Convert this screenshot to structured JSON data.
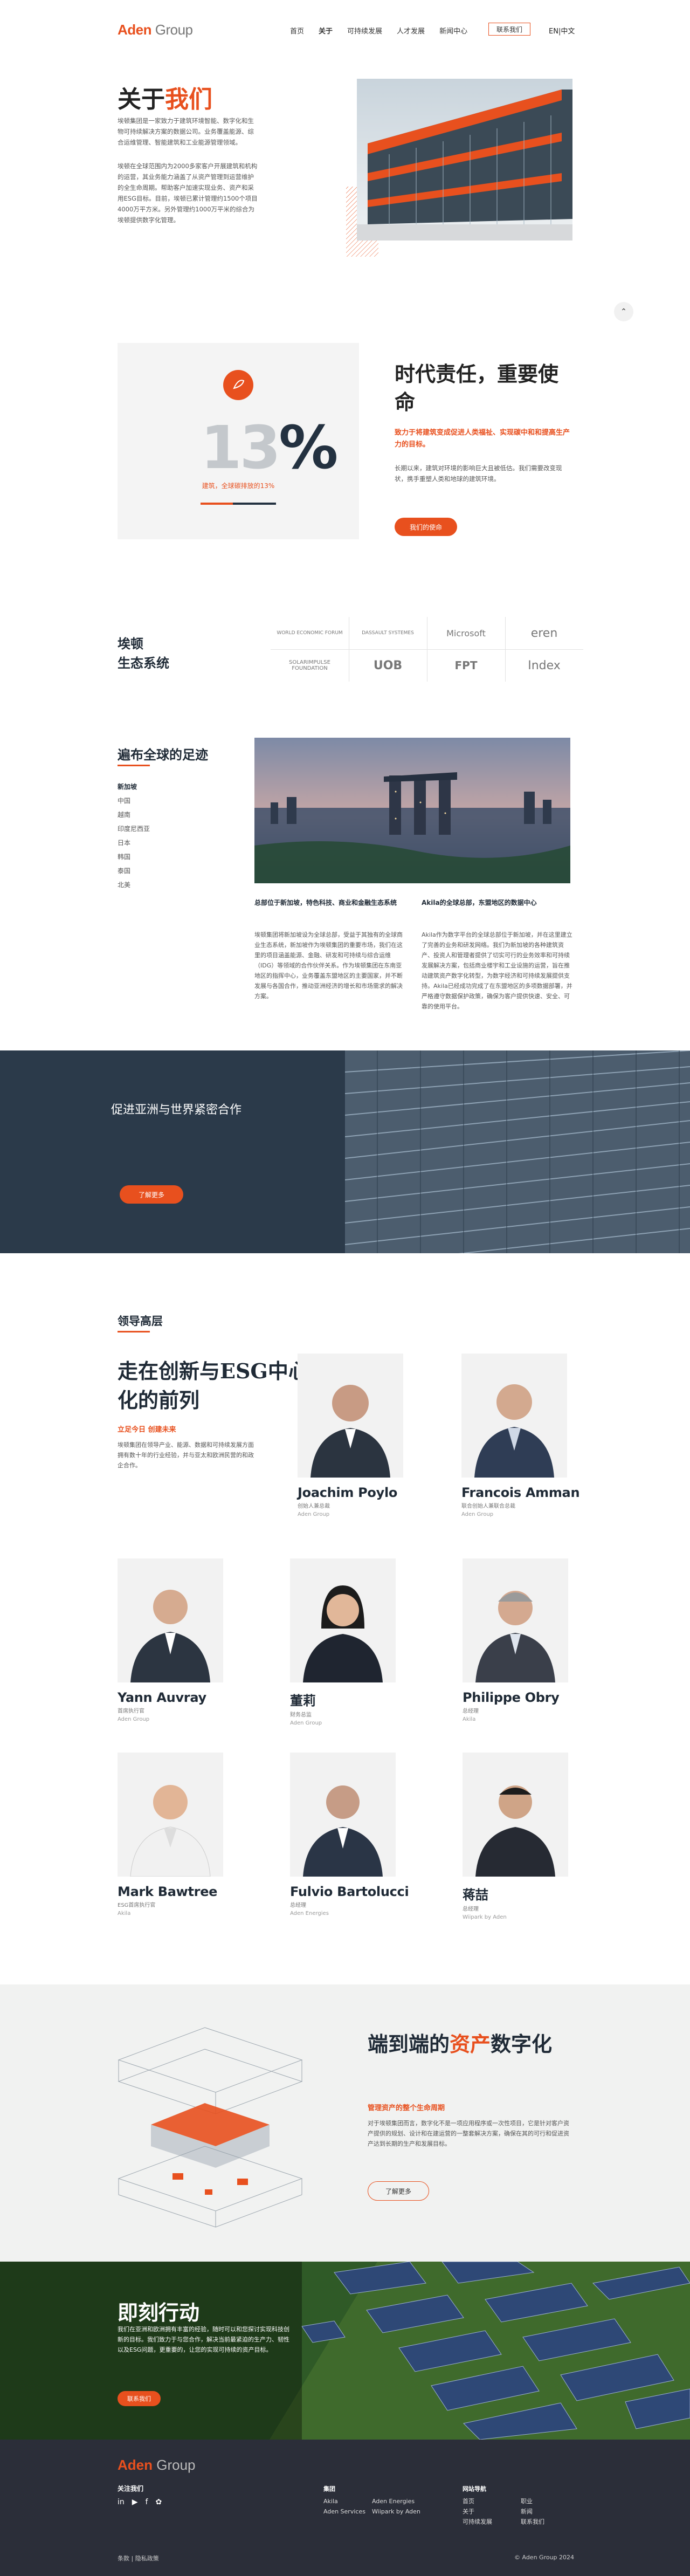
{
  "brand": {
    "name_a": "Aden",
    "name_b": "Group",
    "accent": "#e8501e",
    "dark": "#2b3a4a"
  },
  "nav": {
    "items": [
      "首页",
      "关于",
      "可持续发展",
      "人才发展",
      "新闻中心"
    ],
    "active_index": 1,
    "contact": "联系我们",
    "lang": "EN|中文"
  },
  "about": {
    "title_a": "关于",
    "title_b": "我们",
    "p1": "埃顿集团是一家致力于建筑环境智能、数字化和生物可持续解决方案的数据公司。业务覆盖能源、综合运维管理、智能建筑和工业能源管理领域。",
    "p2": "埃顿在全球范围内为2000多家客户开展建筑和机构的运营，其业务能力涵盖了从资产管理到运营维护的全生命周期。帮助客户加速实现业务、资产和采用ESG目标。目前，埃顿已累计管理约1500个项目4000万平方米。另外管理约1000万平米的综合为埃顿提供数字化管理。",
    "scroll_up": "^"
  },
  "responsibility": {
    "stat_a": "1",
    "stat_b": "3",
    "stat_c": "%",
    "stat_caption": "建筑，全球碳排放的13%",
    "title": "时代责任，重要使命",
    "subtitle": "致力于将建筑变成促进人类福祉、实现碳中和和提高生产力的目标。",
    "p": "长期以来，建筑对环境的影响巨大且被低估。我们需要改变现状，携手重塑人类和地球的建筑环境。",
    "button": "我们的使命"
  },
  "ecosystem": {
    "title_1": "埃顿",
    "title_2": "生态系统",
    "partners": [
      "WORLD ECONOMIC FORUM",
      "DASSAULT SYSTEMES",
      "Microsoft",
      "eren",
      "SOLARIMPULSE FOUNDATION",
      "UOB",
      "FPT",
      "Index"
    ]
  },
  "footprint": {
    "title": "遍布全球的足迹",
    "regions": [
      "新加坡",
      "中国",
      "越南",
      "印度尼西亚",
      "日本",
      "韩国",
      "泰国",
      "北美"
    ],
    "selected_index": 0,
    "col1_heading": "总部位于新加坡，特色科技、商业和金融生态系统",
    "col1_text": "埃顿集团将新加坡设为全球总部，受益于其独有的全球商业生态系统，新加坡作为埃顿集团的重要市场，我们在这里的项目涵盖能源、金融、研发和可持续与综合运维（IDG）等领域的合作伙伴关系。作为埃顿集团在东南亚地区的指挥中心，业务覆盖东盟地区的主要国家，并不断发展与各国合作，推动亚洲经济的增长和市场需求的解决方案。",
    "col2_heading": "Akila的全球总部，东盟地区的数据中心",
    "col2_text": "Akila作为数字平台的全球总部位于新加坡，并在这里建立了完善的业务和研发网络。我们为新加坡的各种建筑资产、投资人和管理者提供了切实可行的业务效率和可持续发展解决方案，包括商业楼宇和工业设施的运营，旨在推动建筑资产数字化转型，为数字经济和可持续发展提供支持。Akila已经成功完成了在东盟地区的多项数据部署，并严格遵守数据保护政策，确保为客户提供快速、安全、可靠的使用平台。"
  },
  "band": {
    "text": "促进亚洲与世界紧密合作",
    "button": "了解更多"
  },
  "leadership": {
    "label": "领导高层",
    "title": "走在创新与ESG中心化的前列",
    "subtitle": "立足今日 创建未来",
    "p": "埃顿集团在领导产业、能源、数据和可持续发展方面拥有数十年的行业经验，并与亚太和欧洲民营的和政企合作。",
    "people": [
      {
        "name": "Joachim Poylo",
        "role": "创始人兼总裁",
        "company": "Aden Group"
      },
      {
        "name": "Francois Amman",
        "role": "联合创始人兼联合总裁",
        "company": "Aden Group"
      },
      {
        "name": "Yann Auvray",
        "role": "首席执行官",
        "company": "Aden Group"
      },
      {
        "name": "董莉",
        "role": "财务总监",
        "company": "Aden Group"
      },
      {
        "name": "Philippe Obry",
        "role": "总经理",
        "company": "Akila"
      },
      {
        "name": "Mark Bawtree",
        "role": "ESG首席执行官",
        "company": "Akila"
      },
      {
        "name": "Fulvio Bartolucci",
        "role": "总经理",
        "company": "Aden Energies"
      },
      {
        "name": "蒋喆",
        "role": "总经理",
        "company": "Wiipark by Aden"
      }
    ]
  },
  "digital": {
    "title_a": "端到端的",
    "title_b": "资产",
    "title_c": "数字化",
    "subtitle": "管理资产的整个生命周期",
    "p": "对于埃顿集团而言，数字化不是一项应用程序或一次性项目，它是针对客户资产提供的规划、设计和在建运营的一整套解决方案，确保在其的可行和促进资产达到长期的生产和发展目标。",
    "button": "了解更多"
  },
  "act": {
    "title": "即刻行动",
    "p": "我们在亚洲和欧洲拥有丰富的经验，随时可以和您探讨实现科技创新的目标。我们致力于与您合作，解决当前最紧迫的生产力、韧性以及ESG问题，更重要的，让您的实现可持续的资产目标。",
    "button": "联系我们"
  },
  "footer": {
    "follow": "关注我们",
    "social": [
      "in",
      "▶",
      "f",
      "✿"
    ],
    "col_group": {
      "heading": "集团",
      "items": [
        "Akila",
        "Aden Services",
        "Aden Energies",
        "Wiipark by Aden"
      ]
    },
    "col_nav": {
      "heading": "网站导航",
      "items": [
        "首页",
        "关于",
        "可持续发展",
        "职业",
        "新闻",
        "联系我们"
      ]
    },
    "legal": "条款 | 隐私政策",
    "copyright": "© Aden Group 2024"
  }
}
